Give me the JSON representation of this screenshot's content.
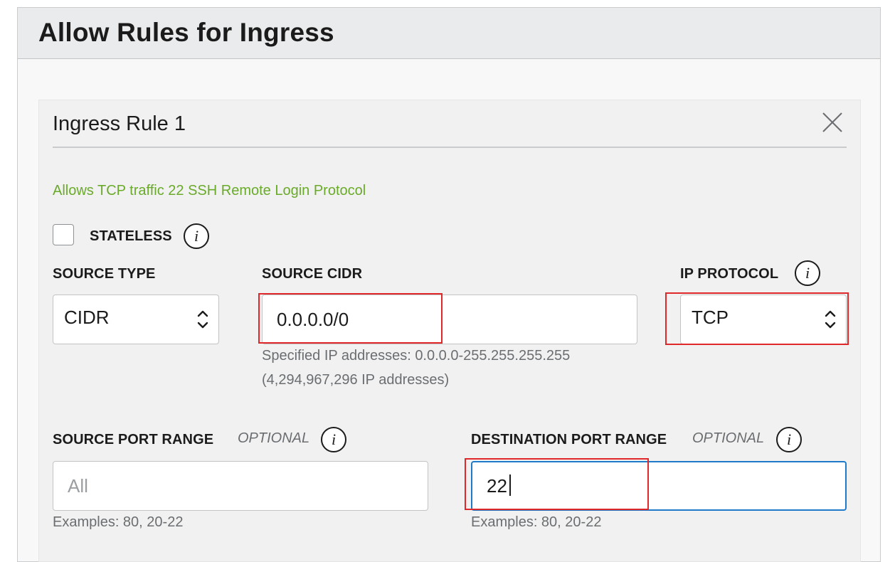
{
  "panel": {
    "title": "Allow Rules for Ingress"
  },
  "rule": {
    "title": "Ingress Rule 1",
    "description": "Allows TCP traffic 22 SSH Remote Login Protocol",
    "stateless_label": "STATELESS",
    "stateless_checked": false
  },
  "source_type": {
    "label": "SOURCE TYPE",
    "value": "CIDR"
  },
  "source_cidr": {
    "label": "SOURCE CIDR",
    "value": "0.0.0.0/0",
    "hint_line1": "Specified IP addresses: 0.0.0.0-255.255.255.255",
    "hint_line2": "(4,294,967,296 IP addresses)"
  },
  "ip_protocol": {
    "label": "IP PROTOCOL",
    "value": "TCP"
  },
  "source_port": {
    "label": "SOURCE PORT RANGE",
    "optional": "OPTIONAL",
    "placeholder": "All",
    "value": "",
    "hint": "Examples: 80, 20-22"
  },
  "dest_port": {
    "label": "DESTINATION PORT RANGE",
    "optional": "OPTIONAL",
    "value": "22",
    "hint": "Examples: 80, 20-22"
  },
  "colors": {
    "accent_green": "#6aaa2a",
    "focus_blue": "#1f7ac9",
    "highlight_red": "#e0282a"
  },
  "icons": [
    "close-icon",
    "info-icon",
    "select-chevron-icon"
  ]
}
